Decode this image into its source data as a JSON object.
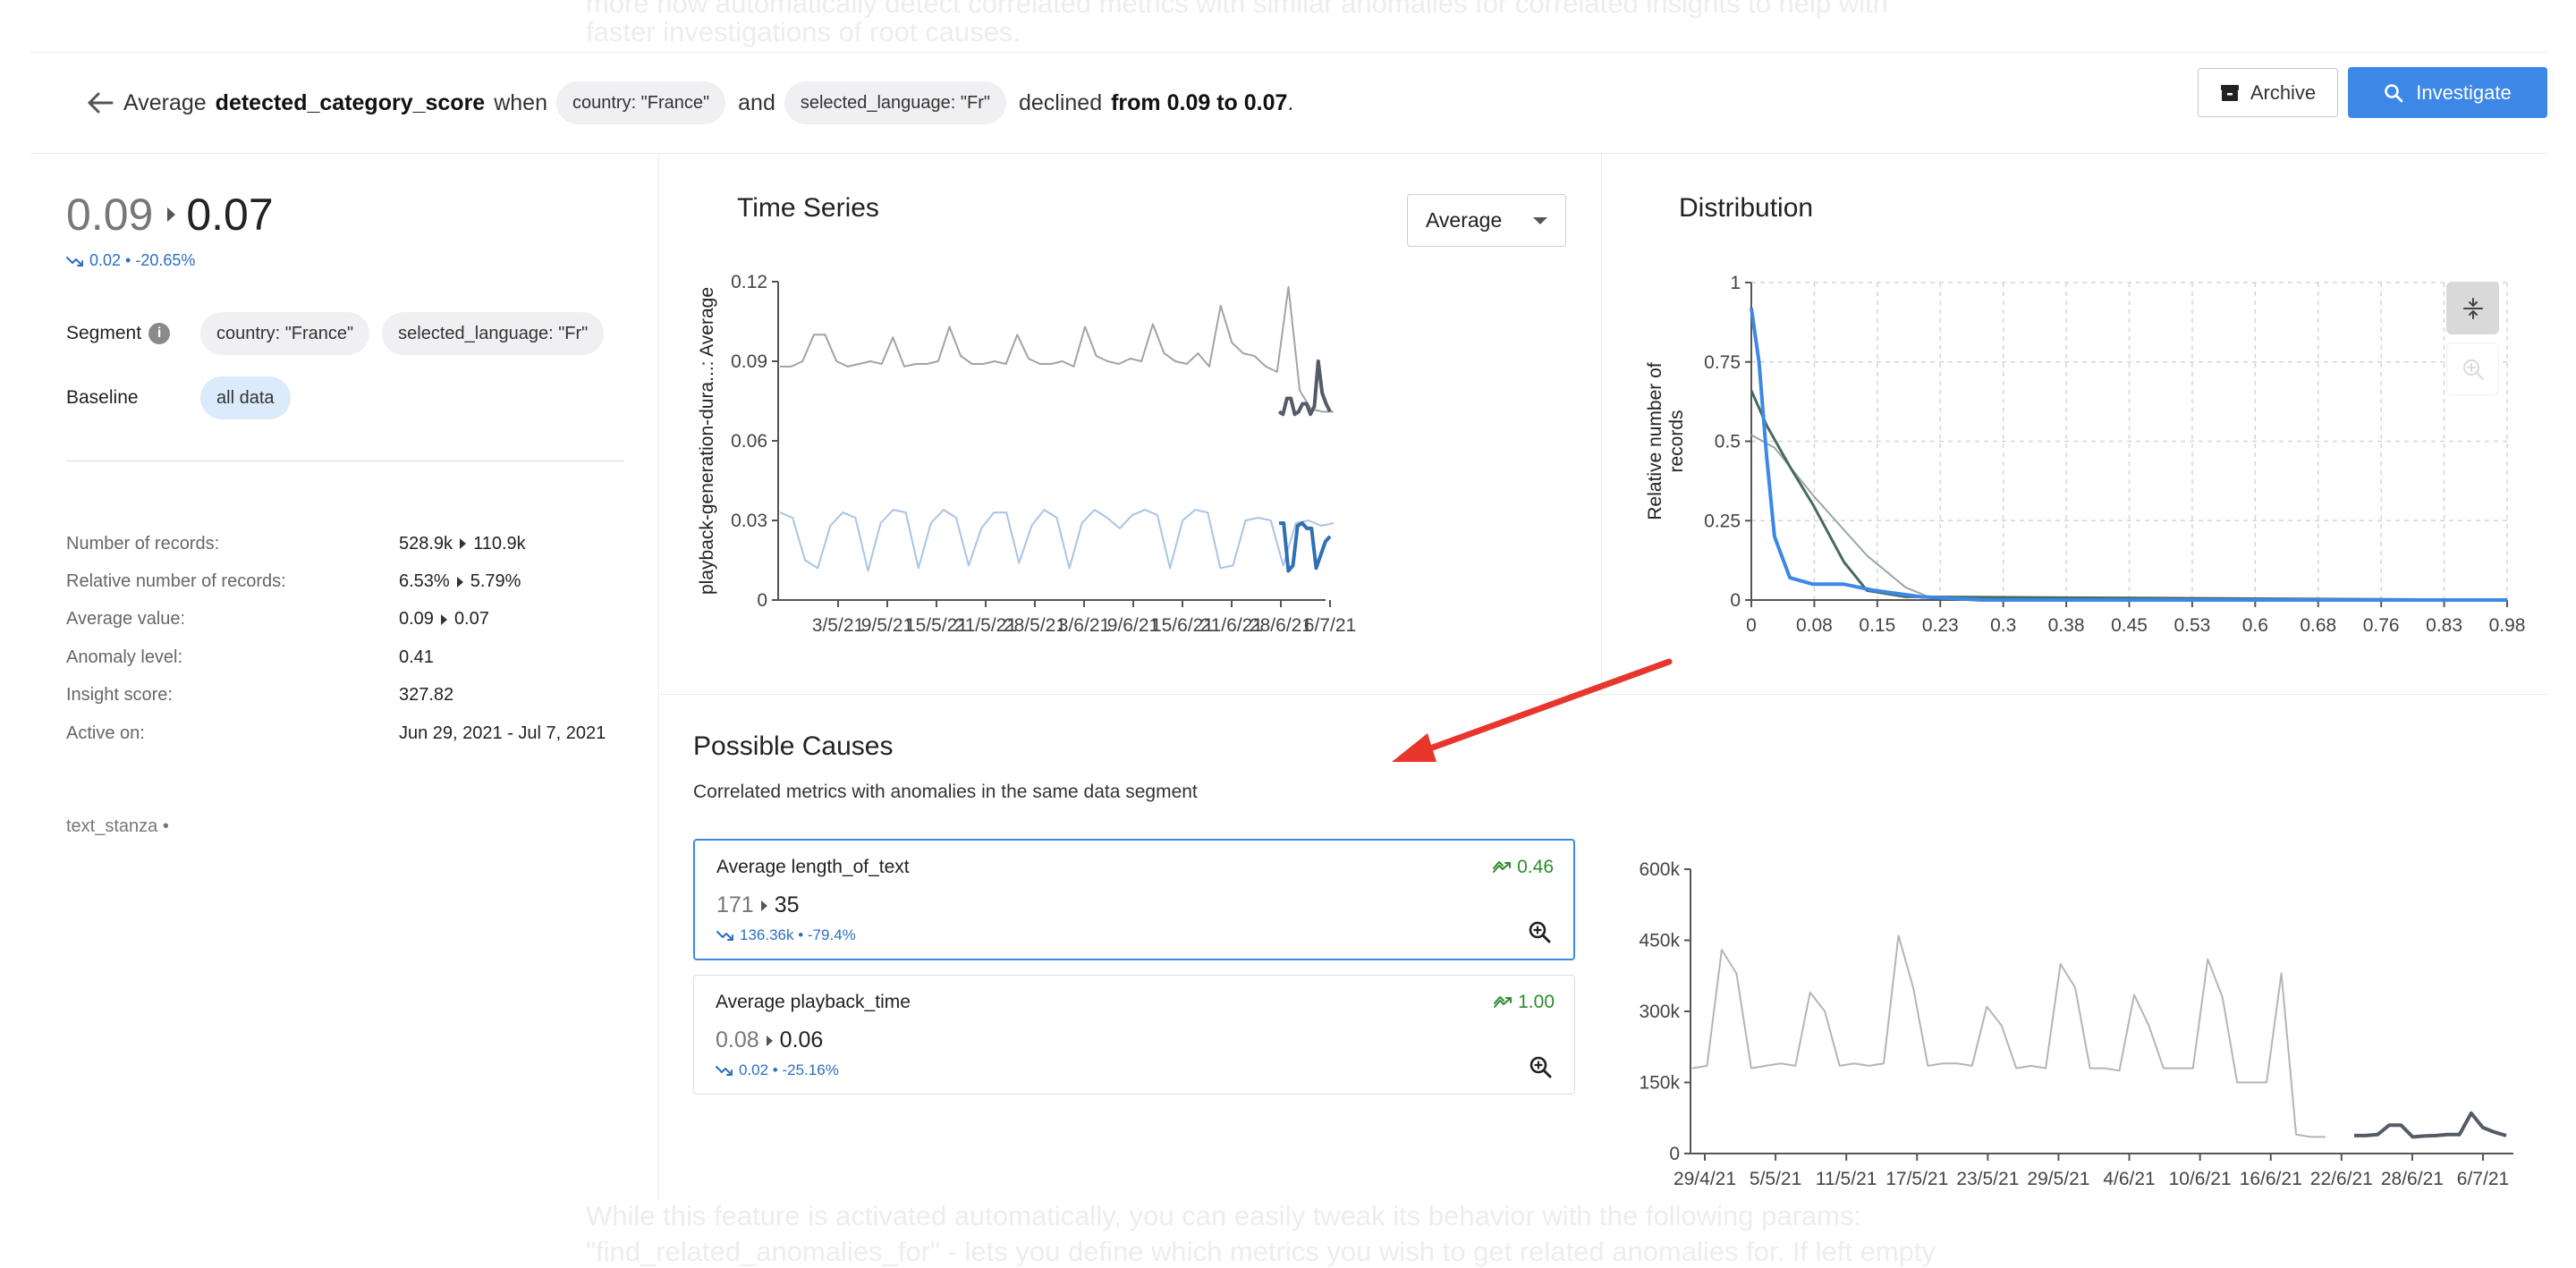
{
  "ghost_text": {
    "top_line_1": "more now automatically detect correlated metrics with similar anomalies for correlated insights to help with",
    "top_line_2": "faster investigations of root causes.",
    "bottom_line_1": "While this feature is activated automatically, you can easily tweak its behavior with the following params:",
    "bottom_line_2": "\"find_related_anomalies_for\" - lets you define which metrics you wish to get related anomalies for. If left empty"
  },
  "header": {
    "back_icon": "arrow-left-icon",
    "prefix": "Average",
    "metric": "detected_category_score",
    "when": "when",
    "segment_1": "country: \"France\"",
    "and": "and",
    "segment_2": "selected_language: \"Fr\"",
    "declined": "declined",
    "change_text": "from 0.09 to 0.07",
    "period": ".",
    "archive_label": "Archive",
    "investigate_label": "Investigate",
    "colors": {
      "primary": "#3d87e6"
    }
  },
  "summary": {
    "from": "0.09",
    "to": "0.07",
    "delta": "0.02 • -20.65%",
    "segment_label": "Segment",
    "segments": [
      "country: \"France\"",
      "selected_language: \"Fr\""
    ],
    "baseline_label": "Baseline",
    "baseline": "all data",
    "stats": [
      {
        "label": "Number of records:",
        "from": "528.9k",
        "to": "110.9k"
      },
      {
        "label": "Relative number of records:",
        "from": "6.53%",
        "to": "5.79%"
      },
      {
        "label": "Average value:",
        "from": "0.09",
        "to": "0.07"
      },
      {
        "label": "Anomaly level:",
        "value": "0.41"
      },
      {
        "label": "Insight score:",
        "value": "327.82"
      },
      {
        "label": "Active on:",
        "value": "Jun 29, 2021 - Jul 7, 2021"
      }
    ],
    "stanza": "text_stanza •"
  },
  "time_series": {
    "title": "Time Series",
    "aggregation": "Average"
  },
  "distribution": {
    "title": "Distribution"
  },
  "causes": {
    "title": "Possible Causes",
    "subtitle": "Correlated metrics with anomalies in the same data segment",
    "items": [
      {
        "name": "Average length_of_text",
        "score": "0.46",
        "from": "171",
        "to": "35",
        "delta": "136.36k • -79.4%"
      },
      {
        "name": "Average playback_time",
        "score": "1.00",
        "from": "0.08",
        "to": "0.06",
        "delta": "0.02 • -25.16%"
      }
    ]
  },
  "chart_data": [
    {
      "type": "line",
      "ylabel": "playback-generation-dura...: Average",
      "ylim": [
        0,
        0.12
      ],
      "y_ticks": [
        "0",
        "0.03",
        "0.06",
        "0.09",
        "0.12"
      ],
      "x_ticks": [
        "3/5/21",
        "9/5/21",
        "15/5/21",
        "21/5/21",
        "28/5/21",
        "3/6/21",
        "9/6/21",
        "15/6/21",
        "21/6/21",
        "28/6/21",
        "6/7/21"
      ],
      "grid": false,
      "series": [
        {
          "values": [
            0.088,
            0.088,
            0.09,
            0.1,
            0.1,
            0.09,
            0.088,
            0.089,
            0.09,
            0.089,
            0.099,
            0.088,
            0.089,
            0.089,
            0.09,
            0.103,
            0.092,
            0.089,
            0.089,
            0.09,
            0.089,
            0.1,
            0.091,
            0.089,
            0.089,
            0.09,
            0.088,
            0.103,
            0.092,
            0.09,
            0.089,
            0.091,
            0.09,
            0.104,
            0.093,
            0.09,
            0.089,
            0.093,
            0.088,
            0.111,
            0.097,
            0.093,
            0.092,
            0.088,
            0.086,
            0.118,
            0.079,
            0.072,
            0.071,
            0.071
          ],
          "color": "#a3a3a3"
        },
        {
          "values": [
            0.033,
            0.031,
            0.015,
            0.012,
            0.028,
            0.033,
            0.031,
            0.011,
            0.029,
            0.034,
            0.033,
            0.012,
            0.029,
            0.034,
            0.031,
            0.013,
            0.027,
            0.033,
            0.033,
            0.014,
            0.028,
            0.034,
            0.031,
            0.012,
            0.029,
            0.034,
            0.031,
            0.027,
            0.032,
            0.034,
            0.032,
            0.012,
            0.03,
            0.034,
            0.033,
            0.012,
            0.013,
            0.03,
            0.031,
            0.03,
            0.013,
            0.029,
            0.03,
            0.028,
            0.029
          ],
          "color": "#a8c4e6"
        },
        {
          "values": [
            0.071,
            0.07,
            0.076,
            0.076,
            0.07,
            0.071,
            0.074,
            0.074,
            0.07,
            0.073,
            0.09,
            0.078,
            0.074,
            0.071
          ],
          "color": "#555b66"
        },
        {
          "values": [
            0.029,
            0.029,
            0.011,
            0.013,
            0.028,
            0.029,
            0.027,
            0.027,
            0.012,
            0.017,
            0.022,
            0.024
          ],
          "color": "#2f6fb6"
        }
      ]
    },
    {
      "type": "line",
      "ylabel": "Relative number of records",
      "ylim": [
        0,
        1
      ],
      "y_ticks": [
        "0",
        "0.25",
        "0.5",
        "0.75",
        "1"
      ],
      "x_ticks": [
        "0",
        "0.08",
        "0.15",
        "0.23",
        "0.3",
        "0.38",
        "0.45",
        "0.53",
        "0.6",
        "0.68",
        "0.76",
        "0.83",
        "0.98"
      ],
      "grid": true,
      "series": [
        {
          "x": [
            0,
            0.03,
            0.08,
            0.15,
            0.2,
            0.23,
            0.98
          ],
          "values": [
            0.52,
            0.48,
            0.33,
            0.14,
            0.04,
            0.01,
            0
          ],
          "color": "#9aa8a0"
        },
        {
          "x": [
            0,
            0.02,
            0.05,
            0.08,
            0.12,
            0.15,
            0.2,
            0.98
          ],
          "values": [
            0.66,
            0.55,
            0.42,
            0.3,
            0.12,
            0.03,
            0.01,
            0
          ],
          "color": "#466b5c"
        },
        {
          "x": [
            0,
            0.01,
            0.02,
            0.03,
            0.05,
            0.08,
            0.12,
            0.16,
            0.22,
            0.3,
            0.98
          ],
          "values": [
            0.92,
            0.75,
            0.45,
            0.2,
            0.07,
            0.05,
            0.05,
            0.03,
            0.01,
            0,
            0
          ],
          "color": "#3d87e6"
        }
      ]
    },
    {
      "type": "line",
      "ylim": [
        0,
        600000
      ],
      "y_ticks": [
        "0",
        "150k",
        "300k",
        "450k",
        "600k"
      ],
      "x_ticks": [
        "29/4/21",
        "5/5/21",
        "11/5/21",
        "17/5/21",
        "23/5/21",
        "29/5/21",
        "4/6/21",
        "10/6/21",
        "16/6/21",
        "22/6/21",
        "28/6/21",
        "6/7/21"
      ],
      "grid": false,
      "series": [
        {
          "values": [
            180000,
            185000,
            430000,
            380000,
            180000,
            185000,
            190000,
            185000,
            340000,
            300000,
            185000,
            190000,
            185000,
            190000,
            460000,
            350000,
            185000,
            190000,
            190000,
            185000,
            310000,
            270000,
            180000,
            185000,
            180000,
            400000,
            350000,
            180000,
            180000,
            175000,
            335000,
            270000,
            180000,
            180000,
            180000,
            410000,
            330000,
            150000,
            150000,
            150000,
            380000,
            40000,
            35000,
            35000
          ],
          "color": "#b5b5b5"
        },
        {
          "values": [
            38000,
            38000,
            40000,
            60000,
            60000,
            35000,
            37000,
            38000,
            40000,
            40000,
            85000,
            55000,
            45000,
            38000
          ],
          "color": "#555b66"
        }
      ]
    }
  ]
}
